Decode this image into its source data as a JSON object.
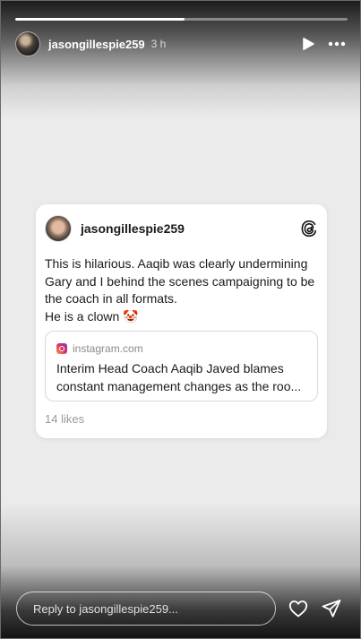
{
  "story": {
    "progress_fraction": 0.51,
    "username": "jasongillespie259",
    "time_ago": "3 h"
  },
  "icons": {
    "play": "play-icon",
    "more": "more-horizontal-icon",
    "threads": "threads-icon",
    "source": "instagram-icon",
    "like": "heart-icon",
    "share": "send-icon"
  },
  "post": {
    "author": "jasongillespie259",
    "lines": [
      "This is hilarious. Aaqib was clearly undermining Gary and I behind the scenes campaigning to be the coach in all formats.",
      "He is a clown 🤡"
    ],
    "link": {
      "source": "instagram.com",
      "title": "Interim Head Coach Aaqib Javed blames constant management changes as the roo..."
    },
    "likes": "14 likes"
  },
  "reply": {
    "placeholder": "Reply to jasongillespie259..."
  }
}
